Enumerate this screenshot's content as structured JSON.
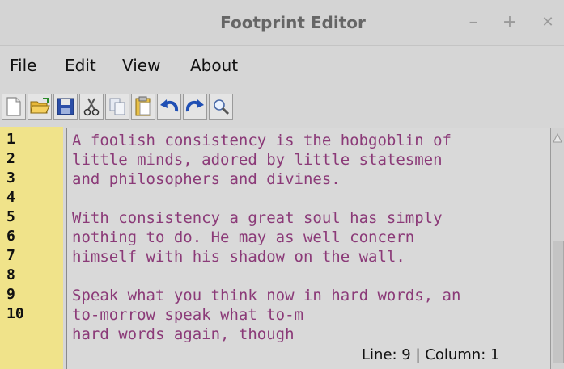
{
  "window": {
    "title": "Footprint Editor",
    "minimize": "–",
    "maximize": "+",
    "close": "✕"
  },
  "menu": [
    "File",
    "Edit",
    "View",
    "About"
  ],
  "toolbar": [
    "new-file-icon",
    "open-folder-icon",
    "save-icon",
    "cut-icon",
    "copy-icon",
    "paste-icon",
    "undo-icon",
    "redo-icon",
    "find-icon"
  ],
  "gutter": {
    "lines": [
      "1",
      "2",
      "3",
      "4",
      "5",
      "6",
      "7",
      "8",
      "9",
      "10"
    ]
  },
  "editor": {
    "lines": [
      "A foolish consistency is the hobgoblin of",
      "little minds, adored by little statesmen",
      "and philosophers and divines.",
      "",
      "With consistency a great soul has simply",
      "nothing to do. He may as well concern",
      "himself with his shadow on the wall.",
      "",
      "Speak what you think now in hard words, an",
      "to-morrow speak what to-m",
      "hard words again, though"
    ]
  },
  "status": {
    "text": "Line: 9 | Column: 1"
  },
  "colors": {
    "gutter": "#f0e38a",
    "text": "#8b3a78",
    "window": "#d6d6d6"
  }
}
